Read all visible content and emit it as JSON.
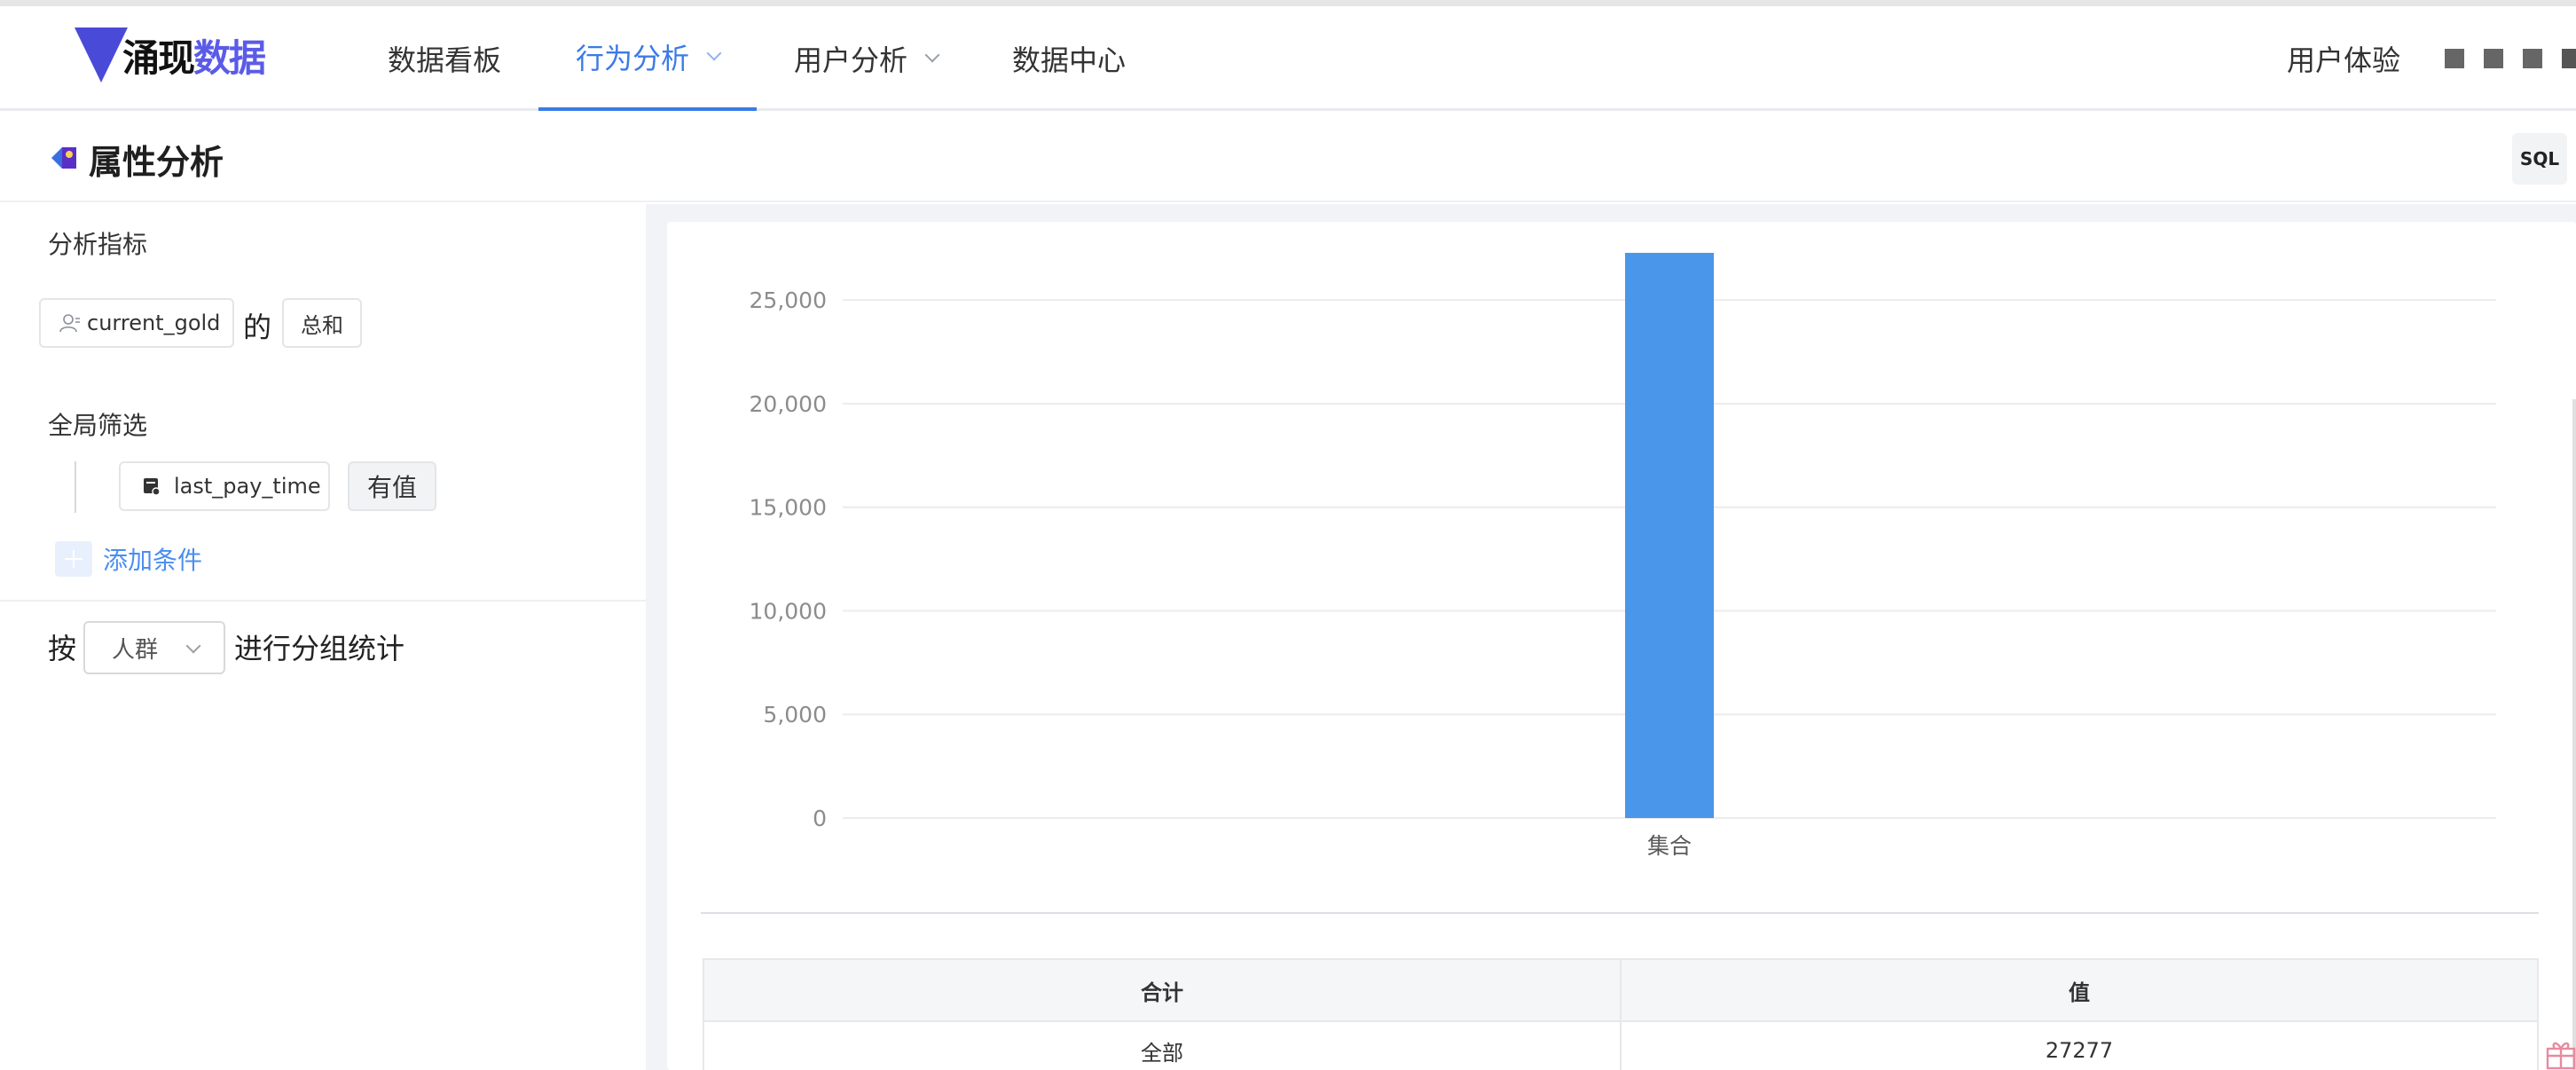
{
  "header": {
    "logo": {
      "part1": "涌现",
      "part2": "数据"
    },
    "nav": [
      {
        "label": "数据看板",
        "active": false,
        "has_menu": false
      },
      {
        "label": "行为分析",
        "active": true,
        "has_menu": true
      },
      {
        "label": "用户分析",
        "active": false,
        "has_menu": true
      },
      {
        "label": "数据中心",
        "active": false,
        "has_menu": false
      }
    ],
    "user_experience": "用户体验"
  },
  "page": {
    "title": "属性分析",
    "sql_button": "SQL"
  },
  "left_panel": {
    "metric_label": "分析指标",
    "metric_field": "current_gold",
    "metric_of": "的",
    "metric_agg": "总和",
    "filter_label": "全局筛选",
    "filter_field": "last_pay_time",
    "filter_op": "有值",
    "add_condition": "添加条件",
    "group_prefix": "按",
    "group_select": "人群",
    "group_suffix": "进行分组统计"
  },
  "colors": {
    "accent": "#3b7be6",
    "bar": "#4a96ea",
    "logo_blue": "#5b5be8"
  },
  "chart_data": {
    "type": "bar",
    "categories": [
      "集合"
    ],
    "series": [
      {
        "values": [
          27277
        ]
      }
    ],
    "ylim": [
      0,
      27277
    ],
    "yticks": [
      0,
      5000,
      10000,
      15000,
      20000,
      25000
    ],
    "ytick_labels": [
      "0",
      "5,000",
      "10,000",
      "15,000",
      "20,000",
      "25,000"
    ],
    "grid": true
  },
  "table": {
    "headers": [
      "合计",
      "值"
    ],
    "rows": [
      [
        "全部",
        "27277"
      ]
    ]
  }
}
